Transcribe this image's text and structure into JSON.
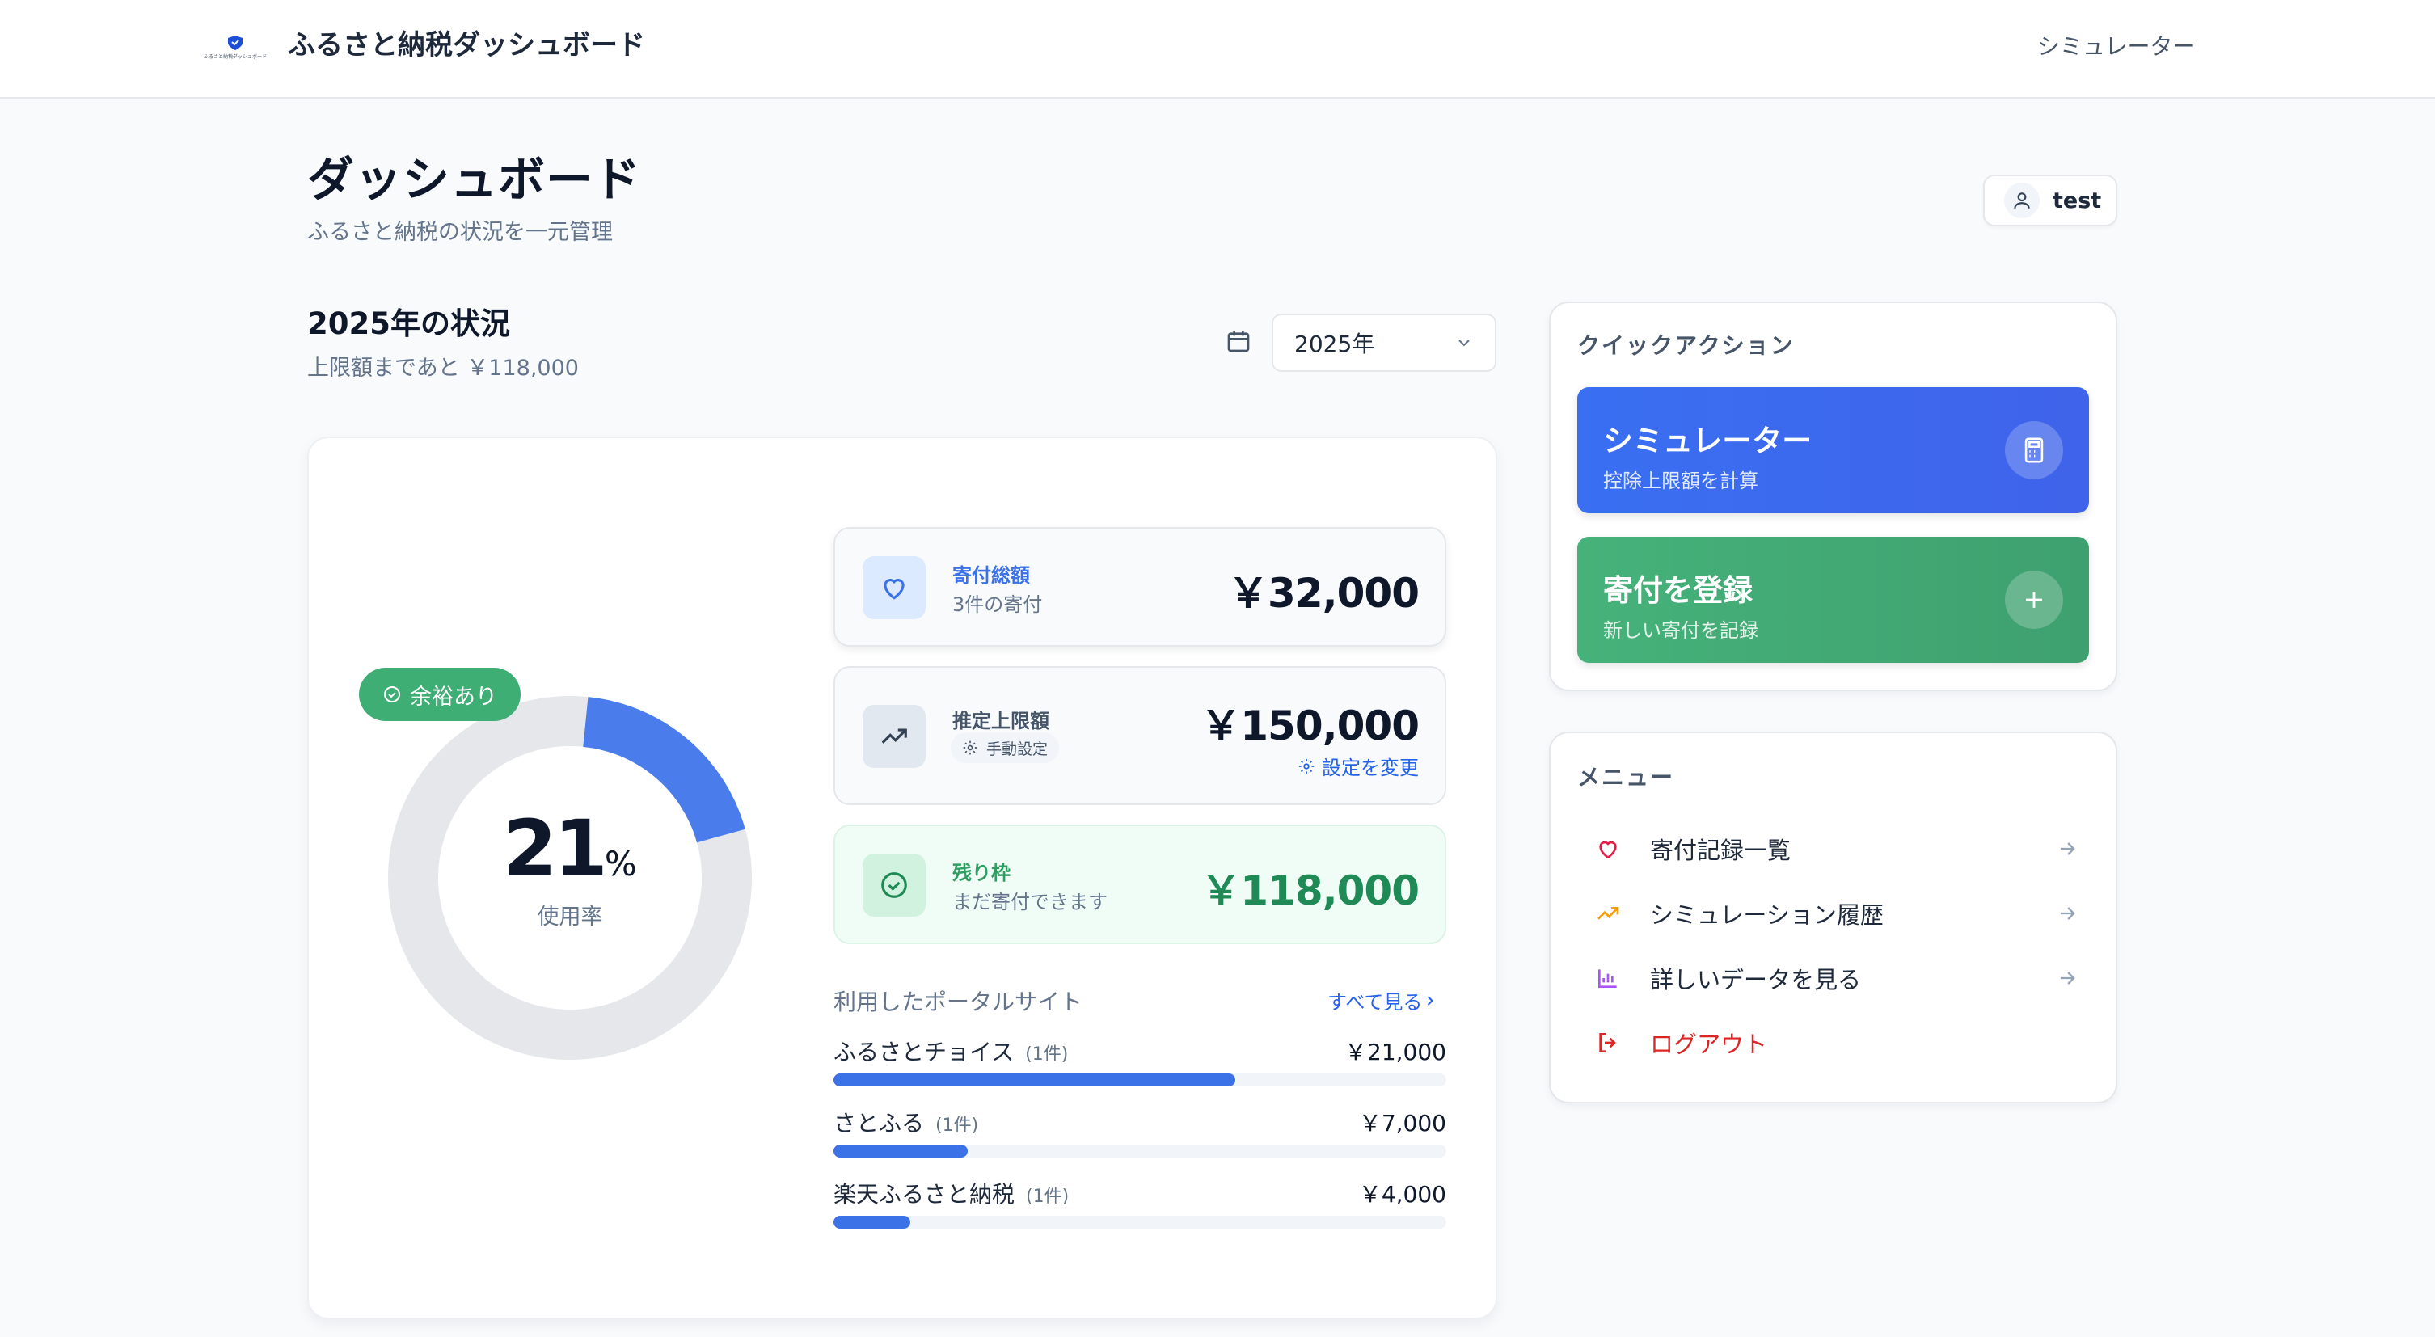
{
  "header": {
    "logo_text": "ふるさと納税ダッシュボード",
    "app_title": "ふるさと納税ダッシュボード",
    "nav_simulator": "シミュレーター"
  },
  "page": {
    "title": "ダッシュボード",
    "subtitle": "ふるさと納税の状況を一元管理"
  },
  "user": {
    "name": "test"
  },
  "status": {
    "title": "2025年の状況",
    "subtitle": "上限額まであと ￥118,000",
    "year_selected": "2025年"
  },
  "gauge": {
    "badge": "余裕あり",
    "percent": 21,
    "percent_text": "21",
    "unit": "%",
    "label": "使用率"
  },
  "stats": {
    "donation": {
      "label": "寄付総額",
      "sub": "3件の寄付",
      "value": "￥32,000"
    },
    "limit": {
      "label": "推定上限額",
      "tag": "手動設定",
      "value": "￥150,000",
      "link": "設定を変更"
    },
    "remaining": {
      "label": "残り枠",
      "sub": "まだ寄付できます",
      "value": "￥118,000"
    }
  },
  "portals": {
    "heading": "利用したポータルサイト",
    "see_all": "すべて見る",
    "items": [
      {
        "name": "ふるさとチョイス",
        "count": "(1件)",
        "value": "￥21,000",
        "share": 0.656
      },
      {
        "name": "さとふる",
        "count": "(1件)",
        "value": "￥7,000",
        "share": 0.219
      },
      {
        "name": "楽天ふるさと納税",
        "count": "(1件)",
        "value": "￥4,000",
        "share": 0.125
      }
    ]
  },
  "quick_actions": {
    "title": "クイックアクション",
    "simulator": {
      "title": "シミュレーター",
      "sub": "控除上限額を計算",
      "icon": "calculator-icon"
    },
    "register": {
      "title": "寄付を登録",
      "sub": "新しい寄付を記録",
      "icon": "plus-icon"
    }
  },
  "menu": {
    "title": "メニュー",
    "items": [
      {
        "label": "寄付記録一覧",
        "icon": "heart-icon"
      },
      {
        "label": "シミュレーション履歴",
        "icon": "trending-up-icon"
      },
      {
        "label": "詳しいデータを見る",
        "icon": "bar-chart-icon"
      },
      {
        "label": "ログアウト",
        "icon": "logout-icon"
      }
    ]
  },
  "colors": {
    "primary": "#3b72e8",
    "success": "#3fae74",
    "danger": "#dc2626",
    "ring_track": "#e5e7eb"
  }
}
